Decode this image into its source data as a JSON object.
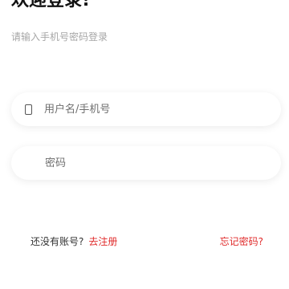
{
  "header": {
    "title": "欢迎登录!",
    "subtitle": "请输入手机号密码登录"
  },
  "form": {
    "phone": {
      "placeholder": "用户名/手机号",
      "value": "",
      "icon": "phone-icon"
    },
    "password": {
      "placeholder": "密码",
      "value": ""
    }
  },
  "footer": {
    "register_prompt": "还没有账号?",
    "register_link": "去注册",
    "forgot_link": "忘记密码?"
  },
  "colors": {
    "accent": "#e02b2b",
    "title": "#111111",
    "subtitle": "#a6a6a6"
  }
}
